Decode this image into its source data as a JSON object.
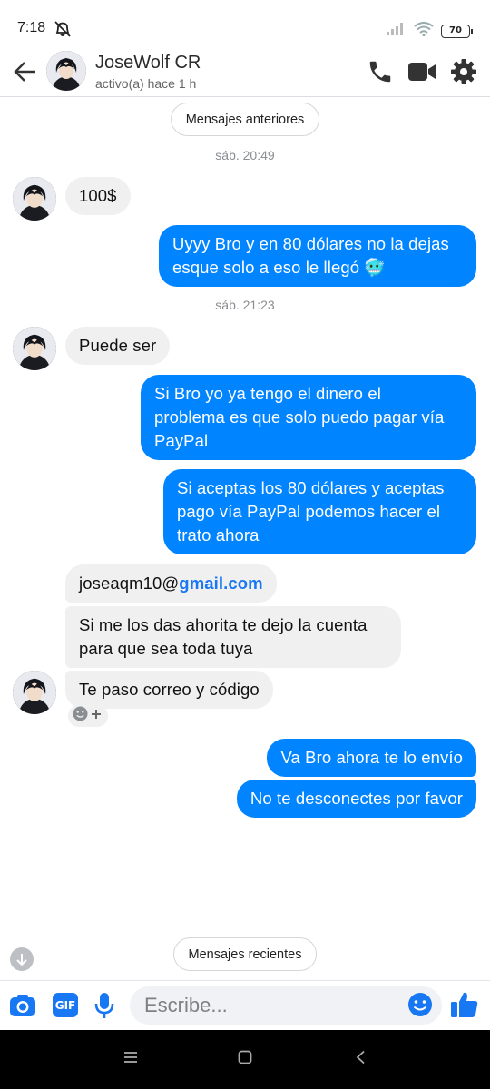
{
  "status_bar": {
    "time": "7:18",
    "battery": "70"
  },
  "header": {
    "contact_name": "JoseWolf CR",
    "status": "activo(a) hace 1 h"
  },
  "older_messages_label": "Mensajes anteriores",
  "recent_messages_label": "Mensajes recientes",
  "timestamps": [
    "sáb. 20:49",
    "sáb. 21:23"
  ],
  "messages": {
    "m1": "100$",
    "m2_line1": "Uyyy Bro y en 80 dólares no la dejas",
    "m2_line2": "esque solo a eso le llegó 🥶",
    "m3": "Puede ser",
    "m4_line1": "Si Bro yo ya tengo el dinero el",
    "m4_line2": "problema es que solo puedo pagar vía",
    "m4_line3": "PayPal",
    "m5_line1": "Si aceptas los 80 dólares y aceptas",
    "m5_line2": "pago  vía PayPal podemos hacer el",
    "m5_line3": "trato ahora",
    "m6_user": "joseaqm10@",
    "m6_domain": "gmail.com",
    "m7_line1": "Si me los das ahorita te dejo la cuenta",
    "m7_line2": "para que sea toda tuya",
    "m8": "Te paso correo y código",
    "m9": "Va Bro ahora te lo envío",
    "m10": "No te desconectes por favor"
  },
  "composer": {
    "placeholder": "Escribe...",
    "gif_label": "GIF"
  },
  "colors": {
    "outgoing": "#0084ff",
    "incoming": "#f0f0f0",
    "accent": "#1877f2"
  },
  "icons": [
    "back-arrow-icon",
    "phone-icon",
    "video-camera-icon",
    "gear-icon",
    "camera-icon",
    "gif-icon",
    "microphone-icon",
    "emoji-icon",
    "thumbs-up-icon",
    "arrow-down-icon"
  ]
}
